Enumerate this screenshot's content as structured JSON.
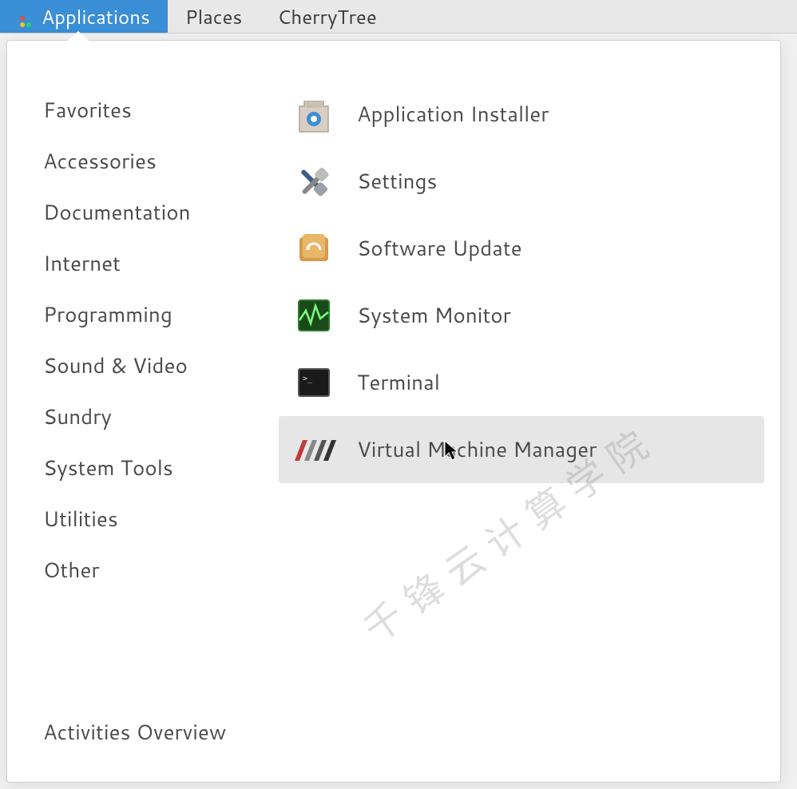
{
  "topbar": {
    "applications": "Applications",
    "places": "Places",
    "cherrytree": "CherryTree"
  },
  "categories": [
    "Favorites",
    "Accessories",
    "Documentation",
    "Internet",
    "Programming",
    "Sound & Video",
    "Sundry",
    "System Tools",
    "Utilities",
    "Other"
  ],
  "activities_overview": "Activities Overview",
  "apps": [
    {
      "label": "Application Installer",
      "icon": "installer"
    },
    {
      "label": "Settings",
      "icon": "settings"
    },
    {
      "label": "Software Update",
      "icon": "update"
    },
    {
      "label": "System Monitor",
      "icon": "monitor"
    },
    {
      "label": "Terminal",
      "icon": "terminal"
    },
    {
      "label": "Virtual Machine Manager",
      "icon": "vmm"
    }
  ],
  "watermark": "千锋云计算学院"
}
